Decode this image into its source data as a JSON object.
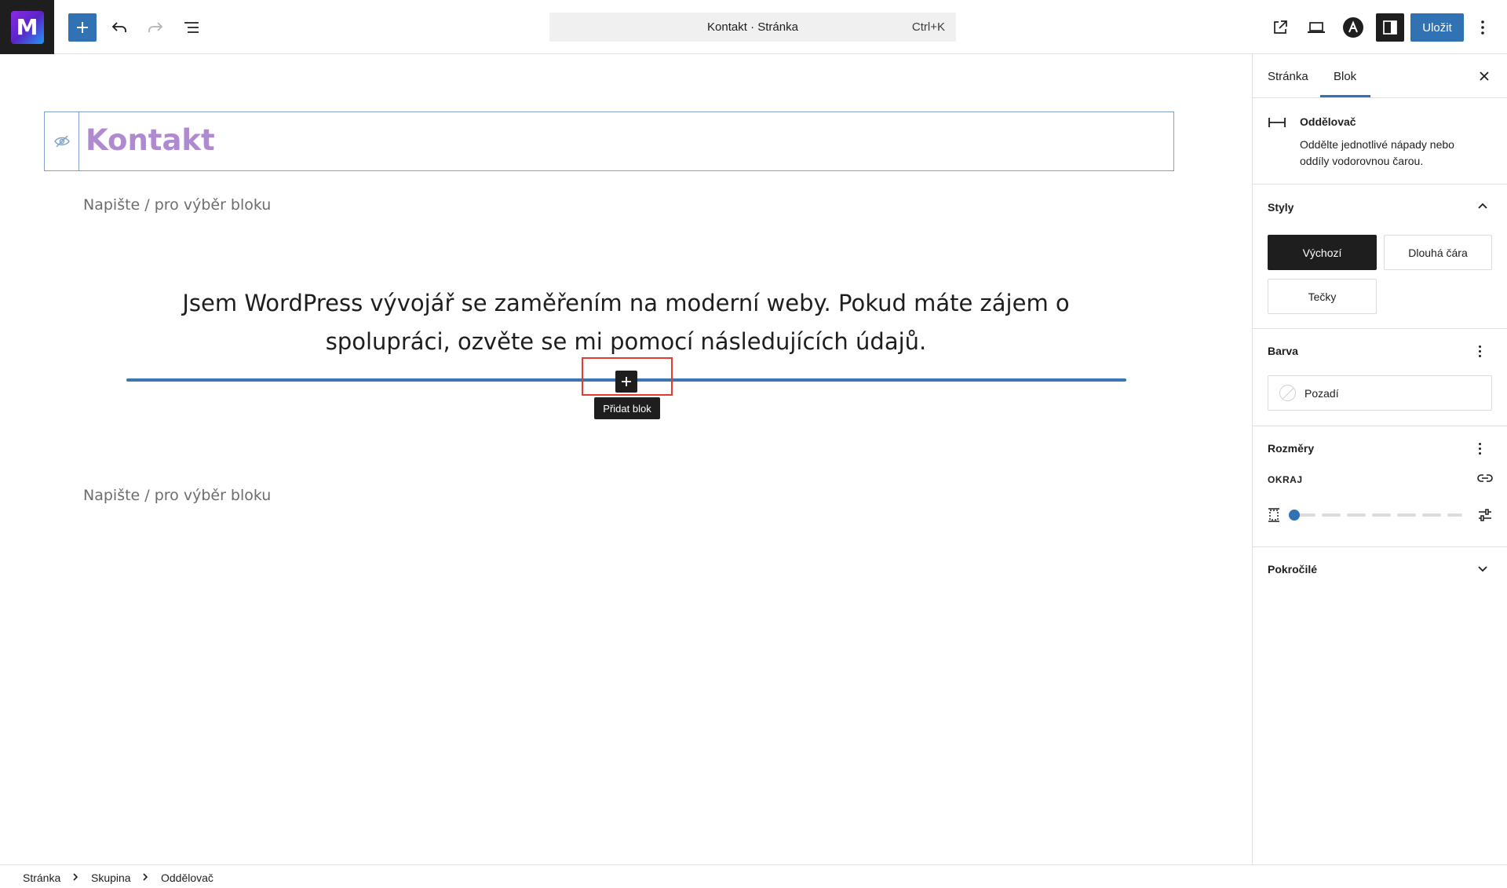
{
  "app": {
    "logo_letter": "M",
    "command_bar": {
      "title": "Kontakt · Stránka",
      "shortcut": "Ctrl+K"
    },
    "save_label": "Uložit",
    "accent_color": "#3072b4"
  },
  "editor": {
    "page_title": "Kontakt",
    "placeholder_1": "Napište / pro výběr bloku",
    "intro_text": "Jsem WordPress vývojář se zaměřením na moderní weby. Pokud máte zájem o spolupráci, ozvěte se mi pomocí následujících údajů.",
    "placeholder_2": "Napište / pro výběr bloku",
    "tooltip": "Přidat blok"
  },
  "sidebar": {
    "tabs": [
      {
        "label": "Stránka"
      },
      {
        "label": "Blok",
        "active": true
      }
    ],
    "block": {
      "name": "Oddělovač",
      "description": "Oddělte jednotlivé nápady nebo oddíly vodorovnou čarou."
    },
    "styles": {
      "title": "Styly",
      "options": [
        {
          "label": "Výchozí",
          "active": true
        },
        {
          "label": "Dlouhá čára"
        },
        {
          "label": "Tečky"
        }
      ]
    },
    "color": {
      "title": "Barva",
      "item_label": "Pozadí"
    },
    "dimensions": {
      "title": "Rozměry",
      "margin_label": "OKRAJ",
      "margin_value": 0
    },
    "advanced": {
      "title": "Pokročilé"
    }
  },
  "breadcrumb": [
    "Stránka",
    "Skupina",
    "Oddělovač"
  ]
}
